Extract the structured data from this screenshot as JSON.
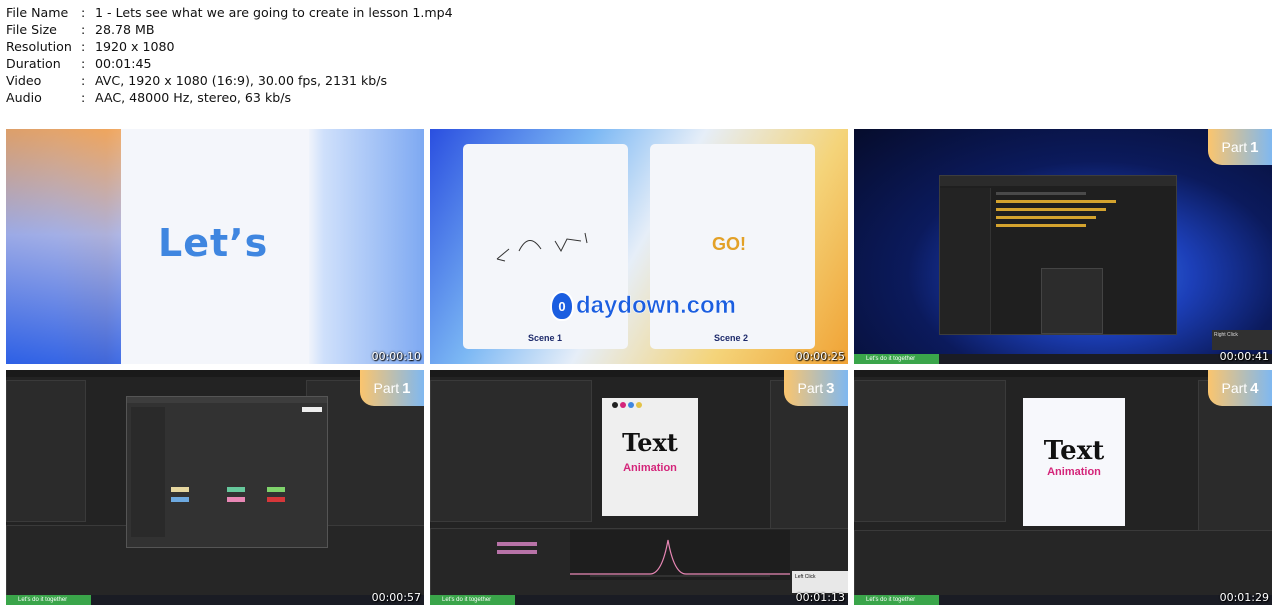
{
  "file_info": [
    {
      "key": "File Name",
      "value": "1 - Lets see what we are going to create in lesson 1.mp4"
    },
    {
      "key": "File Size",
      "value": "28.78 MB"
    },
    {
      "key": "Resolution",
      "value": "1920 x 1080"
    },
    {
      "key": "Duration",
      "value": "00:01:45"
    },
    {
      "key": "Video",
      "value": "AVC, 1920 x 1080 (16:9), 30.00 fps, 2131 kb/s"
    },
    {
      "key": "Audio",
      "value": "AAC, 48000 Hz, stereo, 63 kb/s"
    }
  ],
  "thumbnails": [
    {
      "timestamp": "00:00:10",
      "text": "Let’s"
    },
    {
      "timestamp": "00:00:25",
      "go": "GO!",
      "scene1": "Scene 1",
      "scene2": "Scene 2",
      "watermark": "daydown.com"
    },
    {
      "timestamp": "00:00:41",
      "part_label": "Part",
      "part_num": "1",
      "green": "Let's do it together",
      "hint": "Right Click"
    },
    {
      "timestamp": "00:00:57",
      "part_label": "Part",
      "part_num": "1",
      "green": "Let's do it together"
    },
    {
      "timestamp": "00:01:13",
      "part_label": "Part",
      "part_num": "3",
      "green": "Let's do it together",
      "title1": "Text",
      "title2": "Animation",
      "hint": "Left Click"
    },
    {
      "timestamp": "00:01:29",
      "part_label": "Part",
      "part_num": "4",
      "green": "Let's do it together",
      "title1": "Text",
      "title2": "Animation"
    }
  ],
  "colors": {
    "green_bar": "#3aa54a",
    "go_orange": "#e3a127",
    "lets_blue": "#3f86e0",
    "pink": "#d4257a"
  }
}
